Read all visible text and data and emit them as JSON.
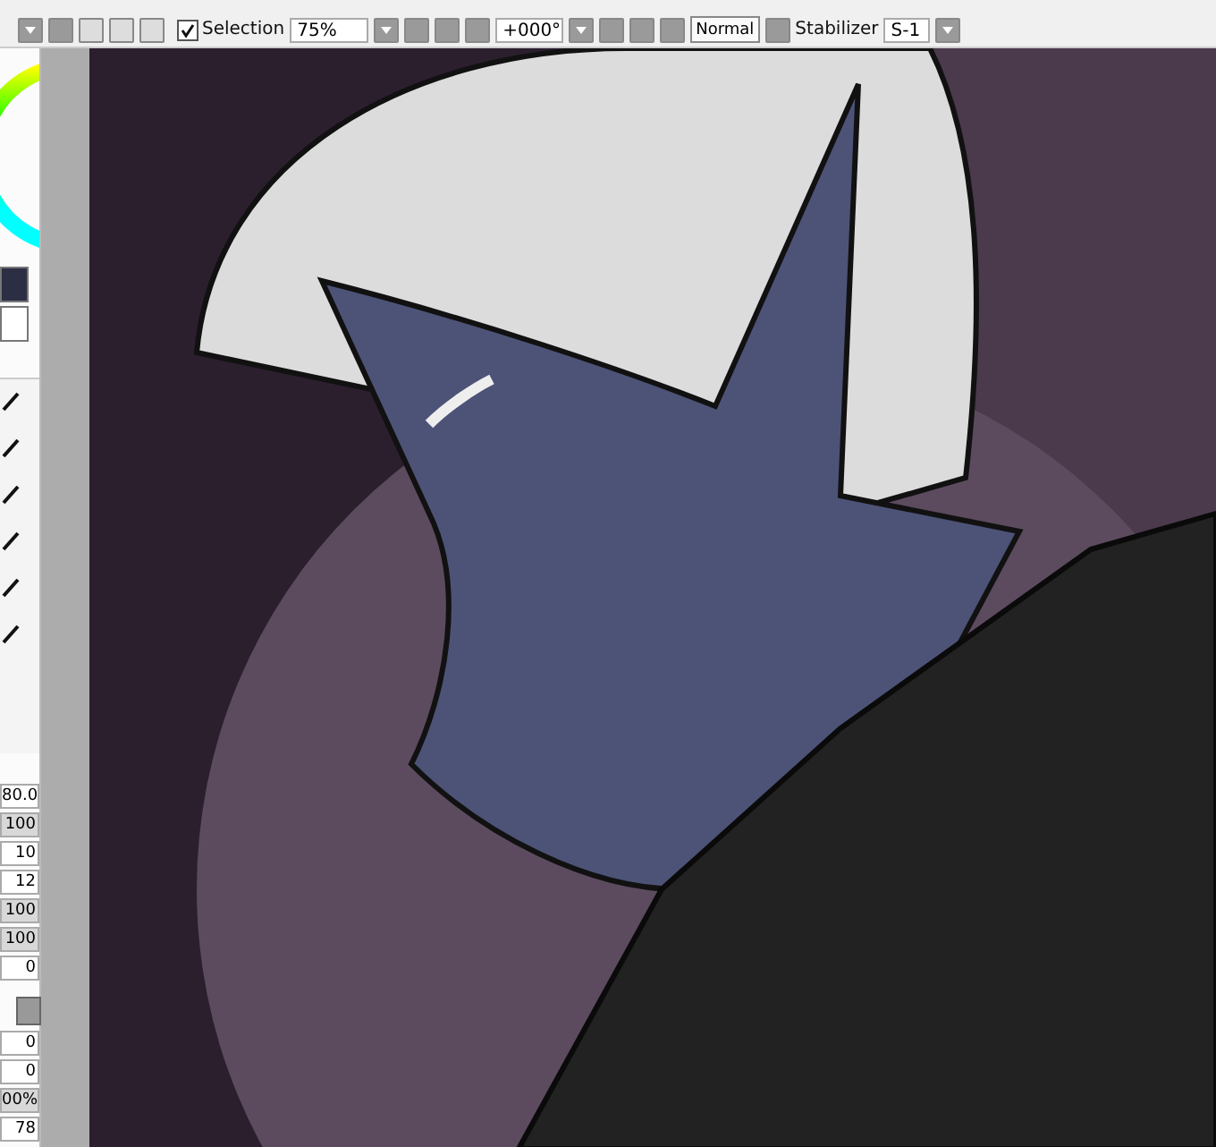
{
  "toolbar": {
    "selection": {
      "label": "Selection",
      "checked": true
    },
    "zoom": "75%",
    "rotation": "+000°",
    "blend_mode": "Normal",
    "stabilizer": {
      "label": "Stabilizer",
      "value": "S-1"
    }
  },
  "tool_panel": {
    "values": [
      "80.0",
      "100",
      "10",
      "12",
      "100",
      "100",
      "0"
    ],
    "values_lower": [
      "0",
      "0",
      "00%",
      "78"
    ]
  }
}
